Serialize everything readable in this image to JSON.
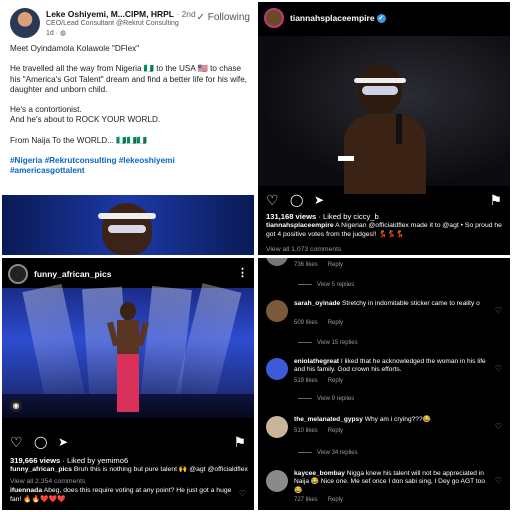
{
  "linkedin": {
    "author": "Leke Oshiyemi, M...CIPM, HRPL",
    "degree": " · 2nd",
    "headline": "CEO/Lead Consultant @Rekrut Consulting",
    "time": "1d · ",
    "follow_label": "✓ Following",
    "paragraphs": [
      "Meet Oyindamola  Kolawole \"DFlex\"",
      "He travelled all the way from Nigeria 🇳🇬 to the USA 🇺🇸 to chase his \"America's Got Talent\" dream and find a better life for his wife, daughter and unborn child.",
      "He's a contortionist.\nAnd he's about to ROCK YOUR WORLD.",
      "From Naija To the WORLD... 🇳🇬🇳🇬🇳🇬"
    ],
    "hashtags": "#Nigeria #Rekrutconsulting #lekeoshiyemi #americasgottalent"
  },
  "post1": {
    "username": "tiannahsplaceempire",
    "views": "131,168 views",
    "liked_by": " · Liked by ciccy_b",
    "caption_user": "tiannahsplaceempire",
    "caption": " A Nigerian @officialdflex made it to @agt • So proud he got 4 positive votes from the judges!! 💃💃💃",
    "view_comments": "View all 1,073 comments"
  },
  "post2": {
    "username": "funny_african_pics",
    "views": "319,666 views",
    "liked_by": " · Liked by yemimo6",
    "caption_user": "funny_african_pics",
    "caption": " Bruh this is nothing but pure talent 🙌 @agt @officialdflex",
    "view_comments": "View all 2,354 comments",
    "top_comment_user": "ifuennada",
    "top_comment": " Abeg, does this require voting at any point? He just got a huge fan! 🔥🔥❤️❤️❤️"
  },
  "comments": {
    "first_meta": {
      "likes": "736 likes",
      "reply": "Reply"
    },
    "replies_1": "View 5 replies",
    "items": [
      {
        "user": "sarah_oyinade",
        "text": " Stretchy in indomitable sticker came to reality o",
        "likes": "509 likes",
        "reply": "Reply",
        "replies": "View 15 replies",
        "color": "#7a5a3a"
      },
      {
        "user": "eniolathegreat",
        "text": " I liked that he acknowledged the woman in his life and his family. God crown his efforts.",
        "likes": "519 likes",
        "reply": "Reply",
        "replies": "View 9 replies",
        "color": "#3d5bd9"
      },
      {
        "user": "the_melanated_gypsy",
        "text": " Why am i crying???😂",
        "likes": "510 likes",
        "reply": "Reply",
        "replies": "View 34 replies",
        "color": "#c9b59a"
      },
      {
        "user": "kaycee_bombay",
        "text": " Nigga knew his talent will not be appreciated in Naija 😂 Nice one. Me sef once I don sabi sing, I Dey go AGT too 😂",
        "likes": "727 likes",
        "reply": "Reply",
        "replies": "",
        "color": "#8a8a8a"
      }
    ]
  },
  "icons": {
    "heart": "♡",
    "comment": "◯",
    "send": "➤",
    "bookmark": "⚑",
    "dots": "⋮"
  }
}
